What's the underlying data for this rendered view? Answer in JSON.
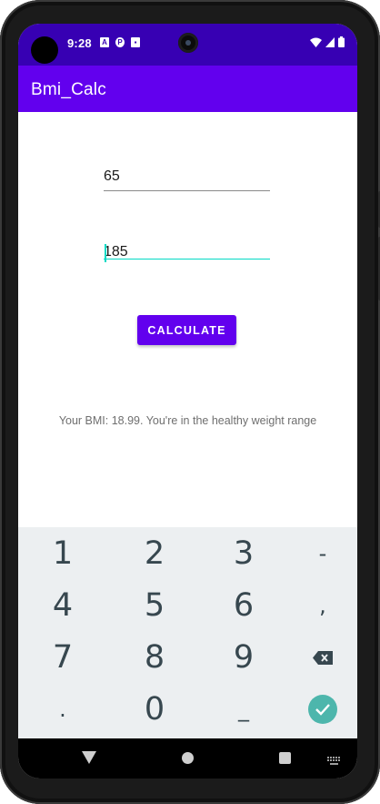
{
  "status_bar": {
    "time": "9:28",
    "notification_icons": [
      "A",
      "P",
      "▪"
    ]
  },
  "app_bar": {
    "title": "Bmi_Calc"
  },
  "form": {
    "weight_value": "65",
    "height_value": "185",
    "calculate_label": "CALCULATE"
  },
  "result": {
    "text": "Your BMI: 18.99. You're in the healthy weight range"
  },
  "keyboard": {
    "rows": [
      [
        "1",
        "2",
        "3",
        "-"
      ],
      [
        "4",
        "5",
        "6",
        ","
      ],
      [
        "7",
        "8",
        "9",
        "backspace"
      ],
      [
        ".",
        "0",
        "_",
        "done"
      ]
    ]
  },
  "colors": {
    "status_bar": "#3700b3",
    "app_bar": "#6200ee",
    "accent": "#03dac5",
    "keyboard_bg": "#eceff1",
    "done_key": "#4db6ac"
  }
}
